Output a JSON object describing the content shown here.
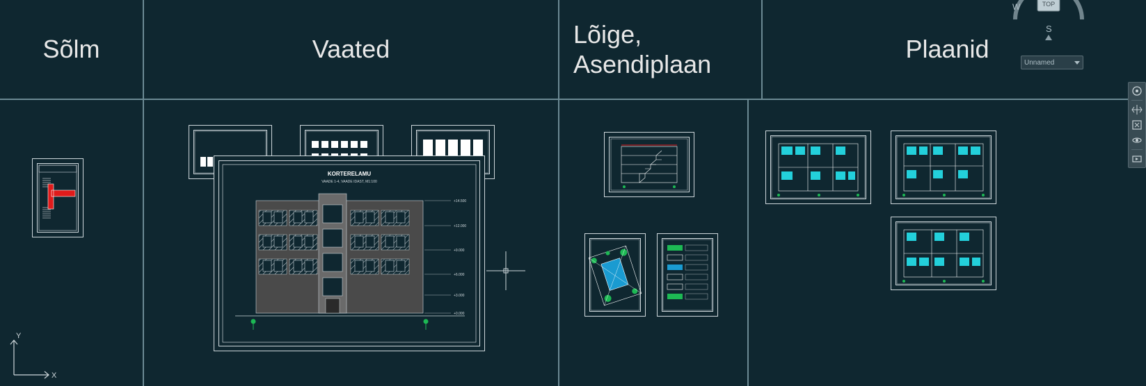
{
  "columns": {
    "c1": "Sõlm",
    "c2": "Vaated",
    "c3": "Lõige,\nAsendiplaan",
    "c4": "Plaanid"
  },
  "elevation": {
    "title": "KORTERELAMU",
    "subtitle": "VAADE 1-4, VAADE IDAST, M1:100",
    "levels": [
      "+0.000",
      "+3.000",
      "+6.000",
      "+9.000",
      "+12.000",
      "+14.500"
    ]
  },
  "ucs": {
    "x": "X",
    "y": "Y"
  },
  "viewcube": {
    "w": "W",
    "s": "S",
    "top": "TOP"
  },
  "unnamed_view": "Unnamed"
}
